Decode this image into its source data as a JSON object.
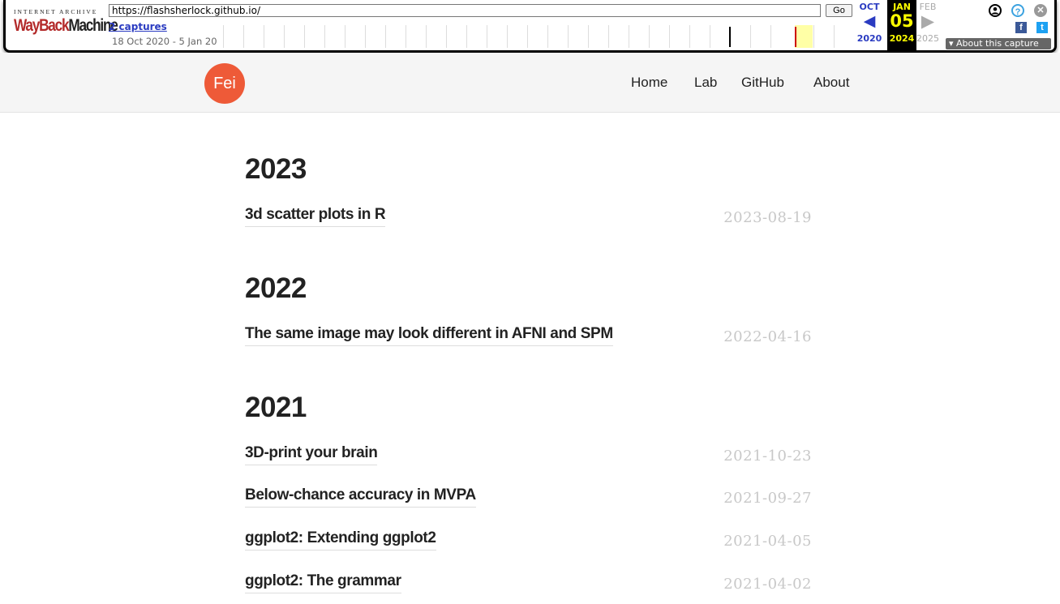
{
  "wayback": {
    "logo_top": "INTERNET ARCHIVE",
    "logo_wayback": "WayBack",
    "logo_machine": "Machine",
    "url": "https://flashsherlock.github.io/",
    "go_label": "Go",
    "captures": "2 captures",
    "range": "18 Oct 2020 - 5 Jan 20",
    "prev": {
      "month": "OCT",
      "arrow": "◀",
      "year": "2020"
    },
    "current": {
      "month": "JAN",
      "day": "05",
      "year": "2024"
    },
    "next": {
      "month": "FEB",
      "arrow": "▶",
      "year": "2025"
    },
    "about_label": "▾ About this capture",
    "icons": {
      "user": "user-icon",
      "help": "help-icon",
      "close": "close-icon",
      "facebook": "facebook-icon",
      "twitter": "twitter-icon"
    },
    "icon_glyphs": {
      "help": "?",
      "close": "✕",
      "facebook": "f",
      "twitter": "t"
    },
    "accent": "#2a3bc1",
    "highlight": "#ffff00"
  },
  "site": {
    "avatar_text": "Fei",
    "avatar_color": "#ee5a38",
    "nav": [
      "Home",
      "Lab",
      "GitHub",
      "About"
    ]
  },
  "posts": {
    "groups": [
      {
        "year": "2023",
        "items": [
          {
            "title": "3d scatter plots in R",
            "date": "2023-08-19"
          }
        ]
      },
      {
        "year": "2022",
        "items": [
          {
            "title": "The same image may look different in AFNI and SPM",
            "date": "2022-04-16"
          }
        ]
      },
      {
        "year": "2021",
        "items": [
          {
            "title": "3D-print your brain",
            "date": "2021-10-23"
          },
          {
            "title": "Below-chance accuracy in MVPA",
            "date": "2021-09-27"
          },
          {
            "title": "ggplot2: Extending ggplot2",
            "date": "2021-04-05"
          },
          {
            "title": "ggplot2: The grammar",
            "date": "2021-04-02"
          }
        ]
      }
    ]
  }
}
